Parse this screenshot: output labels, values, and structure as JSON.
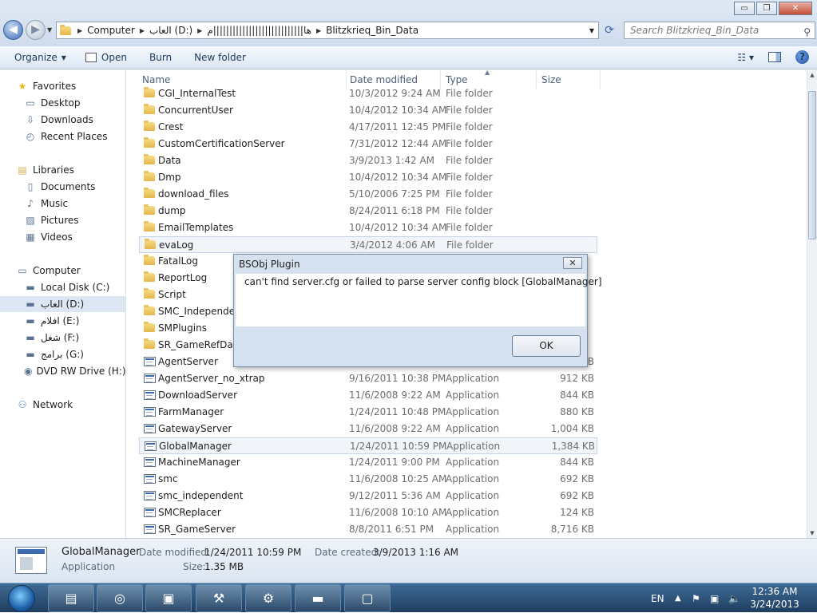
{
  "window": {
    "buttons": {
      "minimize": "▭",
      "maximize": "❐",
      "close": "✕"
    }
  },
  "address": {
    "segments": [
      "Computer",
      "العاب (D:)",
      "ها||||||||||||||||||||||||||||م",
      "Blitzkrieq_Bin_Data"
    ],
    "search_placeholder": "Search Blitzkrieq_Bin_Data"
  },
  "toolbar": {
    "organize": "Organize",
    "open": "Open",
    "burn": "Burn",
    "new_folder": "New folder"
  },
  "nav": [
    {
      "label": "Favorites",
      "icon": "star-icon",
      "indent": 0
    },
    {
      "label": "Desktop",
      "icon": "desktop-icon",
      "indent": 1
    },
    {
      "label": "Downloads",
      "icon": "downloads-icon",
      "indent": 1
    },
    {
      "label": "Recent Places",
      "icon": "recent-places-icon",
      "indent": 1
    },
    {
      "label": "Libraries",
      "icon": "libraries-icon",
      "indent": 0
    },
    {
      "label": "Documents",
      "icon": "documents-icon",
      "indent": 1
    },
    {
      "label": "Music",
      "icon": "music-icon",
      "indent": 1
    },
    {
      "label": "Pictures",
      "icon": "pictures-icon",
      "indent": 1
    },
    {
      "label": "Videos",
      "icon": "videos-icon",
      "indent": 1
    },
    {
      "label": "Computer",
      "icon": "computer-icon",
      "indent": 0
    },
    {
      "label": "Local Disk (C:)",
      "icon": "drive-icon",
      "indent": 1
    },
    {
      "label": "العاب (D:)",
      "icon": "drive-icon",
      "indent": 1,
      "selected": true
    },
    {
      "label": "افلام (E:)",
      "icon": "drive-icon",
      "indent": 1
    },
    {
      "label": "شغل (F:)",
      "icon": "drive-icon",
      "indent": 1
    },
    {
      "label": "برامج (G:)",
      "icon": "drive-icon",
      "indent": 1
    },
    {
      "label": "DVD RW Drive (H:) V",
      "icon": "dvd-drive-icon",
      "indent": 1
    },
    {
      "label": "Network",
      "icon": "network-icon",
      "indent": 0
    }
  ],
  "columns": {
    "name": "Name",
    "date": "Date modified",
    "type": "Type",
    "size": "Size"
  },
  "files": [
    {
      "name": "CGI_InternalTest",
      "date": "10/3/2012 9:24 AM",
      "type": "File folder",
      "size": "",
      "kind": "folder"
    },
    {
      "name": "ConcurrentUser",
      "date": "10/4/2012 10:34 AM",
      "type": "File folder",
      "size": "",
      "kind": "folder"
    },
    {
      "name": "Crest",
      "date": "4/17/2011 12:45 PM",
      "type": "File folder",
      "size": "",
      "kind": "folder"
    },
    {
      "name": "CustomCertificationServer",
      "date": "7/31/2012 12:44 AM",
      "type": "File folder",
      "size": "",
      "kind": "folder"
    },
    {
      "name": "Data",
      "date": "3/9/2013 1:42 AM",
      "type": "File folder",
      "size": "",
      "kind": "folder"
    },
    {
      "name": "Dmp",
      "date": "10/4/2012 10:34 AM",
      "type": "File folder",
      "size": "",
      "kind": "folder"
    },
    {
      "name": "download_files",
      "date": "5/10/2006 7:25 PM",
      "type": "File folder",
      "size": "",
      "kind": "folder"
    },
    {
      "name": "dump",
      "date": "8/24/2011 6:18 PM",
      "type": "File folder",
      "size": "",
      "kind": "folder"
    },
    {
      "name": "EmailTemplates",
      "date": "10/4/2012 10:34 AM",
      "type": "File folder",
      "size": "",
      "kind": "folder"
    },
    {
      "name": "evaLog",
      "date": "3/4/2012 4:06 AM",
      "type": "File folder",
      "size": "",
      "kind": "folder",
      "hover": true
    },
    {
      "name": "FatalLog",
      "date": "",
      "type": "",
      "size": "",
      "kind": "folder"
    },
    {
      "name": "ReportLog",
      "date": "",
      "type": "",
      "size": "",
      "kind": "folder"
    },
    {
      "name": "Script",
      "date": "",
      "type": "",
      "size": "",
      "kind": "folder"
    },
    {
      "name": "SMC_Independent",
      "date": "",
      "type": "",
      "size": "",
      "kind": "folder"
    },
    {
      "name": "SMPlugins",
      "date": "",
      "type": "",
      "size": "",
      "kind": "folder"
    },
    {
      "name": "SR_GameRefData",
      "date": "",
      "type": "",
      "size": "",
      "kind": "folder"
    },
    {
      "name": "AgentServer",
      "date": "",
      "type": "",
      "size": "B",
      "kind": "app"
    },
    {
      "name": "AgentServer_no_xtrap",
      "date": "9/16/2011 10:38 PM",
      "type": "Application",
      "size": "912 KB",
      "kind": "app"
    },
    {
      "name": "DownloadServer",
      "date": "11/6/2008 9:22 AM",
      "type": "Application",
      "size": "844 KB",
      "kind": "app"
    },
    {
      "name": "FarmManager",
      "date": "1/24/2011 10:48 PM",
      "type": "Application",
      "size": "880 KB",
      "kind": "app"
    },
    {
      "name": "GatewayServer",
      "date": "11/6/2008 9:22 AM",
      "type": "Application",
      "size": "1,004 KB",
      "kind": "app"
    },
    {
      "name": "GlobalManager",
      "date": "1/24/2011 10:59 PM",
      "type": "Application",
      "size": "1,384 KB",
      "kind": "app",
      "selected": true
    },
    {
      "name": "MachineManager",
      "date": "1/24/2011 9:00 PM",
      "type": "Application",
      "size": "844 KB",
      "kind": "app"
    },
    {
      "name": "smc",
      "date": "11/6/2008 10:25 AM",
      "type": "Application",
      "size": "692 KB",
      "kind": "app"
    },
    {
      "name": "smc_independent",
      "date": "9/12/2011 5:36 AM",
      "type": "Application",
      "size": "692 KB",
      "kind": "app"
    },
    {
      "name": "SMCReplacer",
      "date": "11/6/2008 10:10 AM",
      "type": "Application",
      "size": "124 KB",
      "kind": "app"
    },
    {
      "name": "SR_GameServer",
      "date": "8/8/2011 6:51 PM",
      "type": "Application",
      "size": "8,716 KB",
      "kind": "app"
    }
  ],
  "details": {
    "name": "GlobalManager",
    "type": "Application",
    "date_modified_label": "Date modified:",
    "date_modified": "1/24/2011 10:59 PM",
    "date_created_label": "Date created:",
    "date_created": "3/9/2013 1:16 AM",
    "size_label": "Size:",
    "size": "1.35 MB"
  },
  "dialog": {
    "title": "BSObj Plugin",
    "message": "can't find server.cfg or failed to parse server config block [GlobalManager]",
    "ok": "OK"
  },
  "taskbar": {
    "apps": [
      "explorer-icon",
      "chrome-icon",
      "installer-icon",
      "tools-icon",
      "app-icon",
      "cmd-icon",
      "bsobj-icon"
    ],
    "language": "EN",
    "time": "12:36 AM",
    "date": "3/24/2013"
  }
}
